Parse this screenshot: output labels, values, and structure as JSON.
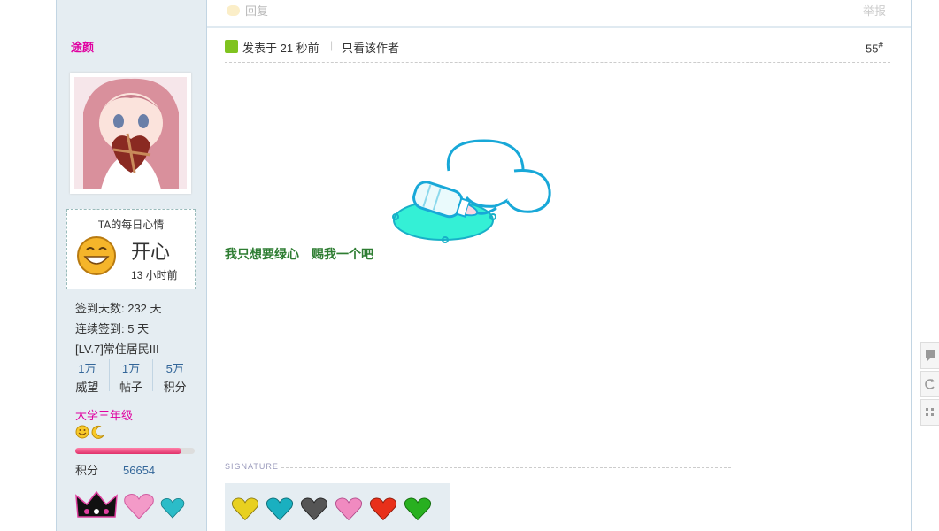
{
  "topbar": {
    "reply_label": "回复",
    "report_label": "举报"
  },
  "author": {
    "name": "途颜",
    "mood": {
      "title": "TA的每日心情",
      "mood": "开心",
      "ago": "13 小时前"
    },
    "stats": {
      "signin_days": "签到天数: 232 天",
      "streak": "连续签到: 5 天",
      "level": "[LV.7]常住居民III"
    },
    "numbers": [
      {
        "value": "1万",
        "label": "威望"
      },
      {
        "value": "1万",
        "label": "帖子"
      },
      {
        "value": "5万",
        "label": "积分"
      }
    ],
    "grade": "大学三年级",
    "progress": 0.89,
    "score_label": "积分",
    "score_value": "56654"
  },
  "post": {
    "posted": "发表于 21 秒前",
    "pipe": "|",
    "only_author": "只看该作者",
    "floor": "55",
    "floor_mark": "#",
    "message": [
      "我只想要绿心",
      "赐我一个吧"
    ],
    "signature_label": "SIGNATURE"
  },
  "colors": {
    "accent_pink": "#e000a0",
    "link_blue": "#336699",
    "message_green": "#2e7d32",
    "sidebar_bg": "#e5edf2"
  },
  "icons": [
    "reply-icon",
    "post-author-icon",
    "grin-face-icon",
    "smile-icon",
    "moon-icon",
    "crown-medal-icon",
    "heart-medal-icon",
    "bottle-sticker-icon"
  ]
}
